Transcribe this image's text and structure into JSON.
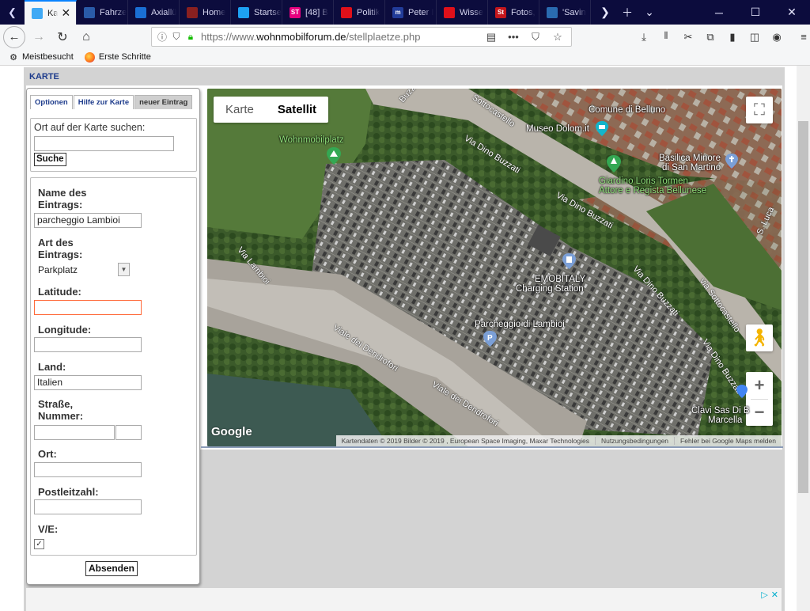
{
  "browser": {
    "tabs": [
      {
        "label": "Ka",
        "favicon": "wohnmobil-favicon",
        "color": "#3fa9f5",
        "active": true
      },
      {
        "label": "Fahrze",
        "favicon": "square-blue-favicon",
        "color": "#2a5ba8"
      },
      {
        "label": "Axiallü",
        "favicon": "axial-favicon",
        "color": "#1a6fd4"
      },
      {
        "label": "Home",
        "favicon": "home-favicon",
        "color": "#8a2020"
      },
      {
        "label": "Startse",
        "favicon": "twitter-favicon",
        "color": "#1da1f2"
      },
      {
        "label": "[48] B",
        "favicon": "st-favicon",
        "color": "#e6007e",
        "glyph": "ST"
      },
      {
        "label": "Politik",
        "favicon": "opera-favicon",
        "color": "#e0101a"
      },
      {
        "label": "Peter I",
        "favicon": "ti-favicon",
        "color": "#223c99",
        "glyph": "m"
      },
      {
        "label": "Wisse",
        "favicon": "opera-favicon",
        "color": "#e0101a"
      },
      {
        "label": "Fotos,",
        "favicon": "st-favicon",
        "color": "#c4161c",
        "glyph": "St"
      },
      {
        "label": "'Savin",
        "favicon": "drop-favicon",
        "color": "#2a6bb0"
      }
    ],
    "url_prefix": "https://www.",
    "url_host": "wohnmobilforum.de",
    "url_path": "/stellplaetze.php",
    "bookmarks": [
      {
        "label": "Meistbesucht",
        "icon": "gear-icon"
      },
      {
        "label": "Erste Schritte",
        "icon": "firefox-icon"
      }
    ]
  },
  "page": {
    "header": "KARTE",
    "tabs": {
      "optionen": "Optionen",
      "hilfe": "Hilfe zur Karte",
      "neuer": "neuer Eintrag"
    },
    "search": {
      "label": "Ort auf der Karte suchen:",
      "value": "",
      "button": "Suche"
    },
    "form": {
      "name_label": "Name des Eintrags:",
      "name_value": "parcheggio Lambioi",
      "art_label": "Art des Eintrags:",
      "art_value": "Parkplatz",
      "lat_label": "Latitude:",
      "lat_value": "",
      "lon_label": "Longitude:",
      "lon_value": "",
      "land_label": "Land:",
      "land_value": "Italien",
      "strasse_label": "Straße, Nummer:",
      "strasse_value": "",
      "nummer_value": "",
      "ort_label": "Ort:",
      "ort_value": "",
      "plz_label": "Postleitzahl:",
      "plz_value": "",
      "ve_label": "V/E:",
      "ve_checked": true,
      "submit": "Absenden"
    },
    "map": {
      "type_karte": "Karte",
      "type_satellit": "Satellit",
      "google": "Google",
      "attribution": "Kartendaten © 2019 Bilder © 2019 , European Space Imaging, Maxar Technologies",
      "terms": "Nutzungsbedingungen",
      "report": "Fehler bei Google Maps melden",
      "labels": {
        "comune": "Comune di Belluno",
        "museo": "Museo Dolom.it",
        "wohnmobilplatz": "Wohnmobilplatz",
        "basilica1": "Basilica Minore",
        "basilica2": "di San Martino",
        "giardino1": "Giardino Loris Tormen",
        "giardino2": "Attore e Regista Bellunese",
        "emobitaly1": "EMOBITALY",
        "emobitaly2": "Charging Station",
        "parcheggio": "Parcheggio di Lambioi",
        "clavi1": "Clavi Sas Di B",
        "clavi2": "Marcella",
        "r_buzzati_top": "Buzzati",
        "r_sottocastello_top": "Sottocastello",
        "r_buzzati1": "Via Dino Buzzati",
        "r_buzzati2": "Via Dino Buzzati",
        "r_buzzati3": "Via Dino Buzzati",
        "r_lambioi": "Via Lambioi",
        "r_sottocastello": "via Sottocastello",
        "r_dendrofori1": "Viale dei Dendrofori",
        "r_dendrofori2": "Viale dei Dendrofori",
        "r_sluca": "S. Luca",
        "r_buzzati4": "Via Dino Buzzati"
      }
    }
  }
}
